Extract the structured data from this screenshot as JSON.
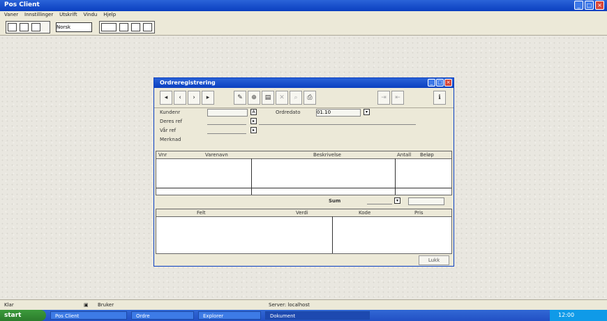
{
  "app": {
    "title": "Pos Client"
  },
  "menu": [
    "Vaner",
    "Innstillinger",
    "Utskrift",
    "Vindu",
    "Hjelp"
  ],
  "toolbar": {
    "select_value": "Norsk"
  },
  "dialog": {
    "title": "Ordreregistrering",
    "toolbar_icons": [
      "first-icon",
      "prev-icon",
      "next-icon",
      "last-icon",
      "new-icon",
      "open-icon",
      "save-icon",
      "delete-icon",
      "find-icon",
      "print-icon",
      "send-icon",
      "exit-icon",
      "info-icon"
    ],
    "form": {
      "customer_label": "Kundenr",
      "ref_label": "Deres ref",
      "ourref_label": "Vår ref",
      "date_label": "Ordredato",
      "date_value": "01.10",
      "note_label": "Merknad"
    },
    "grid1": {
      "headers": [
        "Vnr",
        "Varenavn",
        "Beskrivelse",
        "Antall",
        "Beløp"
      ]
    },
    "sum_label": "Sum",
    "grid2": {
      "headers": [
        "Felt",
        "Verdi",
        "Kode",
        "Pris"
      ]
    },
    "footer_button": "Lukk"
  },
  "status": {
    "left": "Klar",
    "user": "Bruker",
    "center": "Server: localhost"
  },
  "taskbar": {
    "start": "start",
    "tasks": [
      "Pos Client",
      "Ordre",
      "Explorer",
      "Dokument"
    ],
    "clock": "12:00"
  }
}
